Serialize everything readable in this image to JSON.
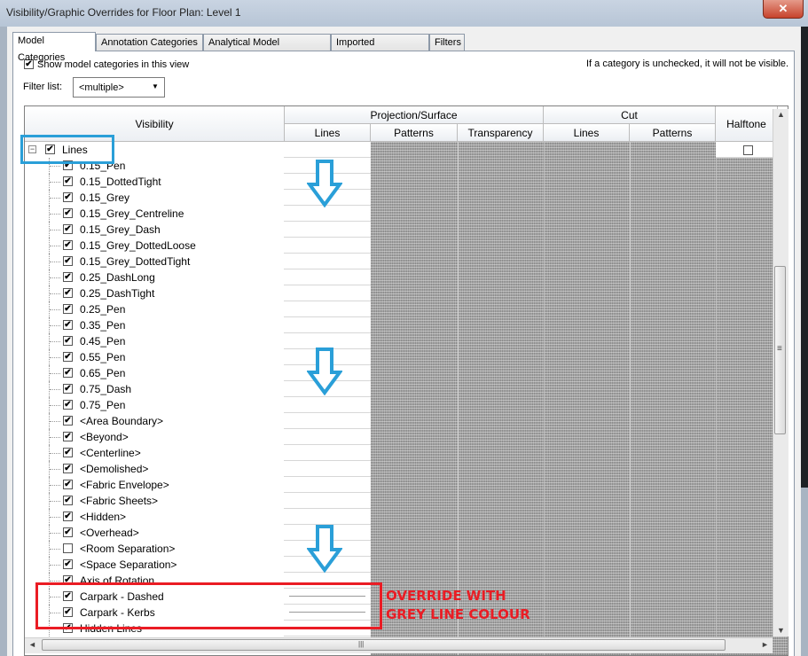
{
  "window": {
    "title": "Visibility/Graphic Overrides for Floor Plan: Level 1",
    "close_glyph": "✕"
  },
  "tabs": [
    {
      "label": "Model Categories",
      "active": true
    },
    {
      "label": "Annotation Categories",
      "active": false
    },
    {
      "label": "Analytical Model Categories",
      "active": false
    },
    {
      "label": "Imported Categories",
      "active": false
    },
    {
      "label": "Filters",
      "active": false
    }
  ],
  "options": {
    "show_model_categories_label": "Show model categories in this view",
    "show_model_categories_checked": true,
    "hint": "If a category is unchecked, it will not be visible.",
    "filter_list_label": "Filter list:",
    "filter_list_value": "<multiple>"
  },
  "grid": {
    "headers": {
      "visibility": "Visibility",
      "projection_surface": "Projection/Surface",
      "cut": "Cut",
      "halftone": "Halftone",
      "proj_lines": "Lines",
      "proj_patterns": "Patterns",
      "proj_transparency": "Transparency",
      "cut_lines": "Lines",
      "cut_patterns": "Patterns"
    },
    "parent_row": {
      "name": "Lines",
      "checked": true,
      "expander": "−"
    },
    "rows": [
      {
        "name": "0.15_Pen",
        "checked": true,
        "override": false
      },
      {
        "name": "0.15_DottedTight",
        "checked": true,
        "override": false
      },
      {
        "name": "0.15_Grey",
        "checked": true,
        "override": false
      },
      {
        "name": "0.15_Grey_Centreline",
        "checked": true,
        "override": false
      },
      {
        "name": "0.15_Grey_Dash",
        "checked": true,
        "override": false
      },
      {
        "name": "0.15_Grey_DottedLoose",
        "checked": true,
        "override": false
      },
      {
        "name": "0.15_Grey_DottedTight",
        "checked": true,
        "override": false
      },
      {
        "name": "0.25_DashLong",
        "checked": true,
        "override": false
      },
      {
        "name": "0.25_DashTight",
        "checked": true,
        "override": false
      },
      {
        "name": "0.25_Pen",
        "checked": true,
        "override": false
      },
      {
        "name": "0.35_Pen",
        "checked": true,
        "override": false
      },
      {
        "name": "0.45_Pen",
        "checked": true,
        "override": false
      },
      {
        "name": "0.55_Pen",
        "checked": true,
        "override": false
      },
      {
        "name": "0.65_Pen",
        "checked": true,
        "override": false
      },
      {
        "name": "0.75_Dash",
        "checked": true,
        "override": false
      },
      {
        "name": "0.75_Pen",
        "checked": true,
        "override": false
      },
      {
        "name": "<Area Boundary>",
        "checked": true,
        "override": false
      },
      {
        "name": "<Beyond>",
        "checked": true,
        "override": false
      },
      {
        "name": "<Centerline>",
        "checked": true,
        "override": false
      },
      {
        "name": "<Demolished>",
        "checked": true,
        "override": false
      },
      {
        "name": "<Fabric Envelope>",
        "checked": true,
        "override": false
      },
      {
        "name": "<Fabric Sheets>",
        "checked": true,
        "override": false
      },
      {
        "name": "<Hidden>",
        "checked": true,
        "override": false
      },
      {
        "name": "<Overhead>",
        "checked": true,
        "override": false
      },
      {
        "name": "<Room Separation>",
        "checked": false,
        "override": false
      },
      {
        "name": "<Space Separation>",
        "checked": true,
        "override": false
      },
      {
        "name": "Axis of Rotation",
        "checked": true,
        "override": false
      },
      {
        "name": "Carpark - Dashed",
        "checked": true,
        "override": true
      },
      {
        "name": "Carpark - Kerbs",
        "checked": true,
        "override": true
      },
      {
        "name": "Hidden Lines",
        "checked": true,
        "override": false
      }
    ]
  },
  "annotation": {
    "line1": "OVERRIDE WITH",
    "line2": "GREY LINE COLOUR",
    "blue": "#2a9fd8",
    "red": "#ea1c24"
  },
  "scroll": {
    "up": "▲",
    "down": "▼",
    "left": "◄",
    "right": "►",
    "grip": "≡",
    "hgrip": "|||"
  }
}
